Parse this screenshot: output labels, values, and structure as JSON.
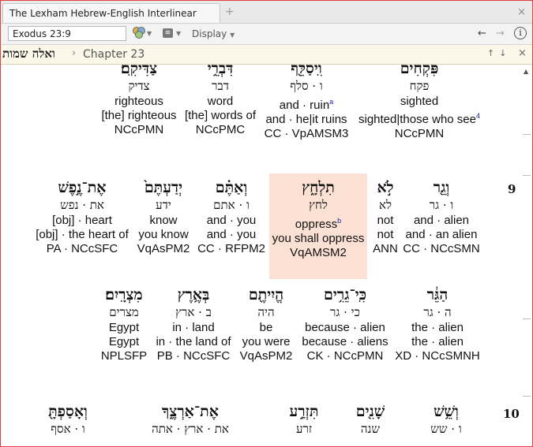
{
  "tab": {
    "title": "The Lexham Hebrew-English Interlinear Bible",
    "new_tab": "+",
    "close": "×"
  },
  "toolbar": {
    "reference": "Exodus 23:9",
    "display_label": "Display",
    "back": "←",
    "forward": "→",
    "info": "i"
  },
  "breadcrumb": {
    "book": "ואלה שמות",
    "separator": "›",
    "chapter": "Chapter 23",
    "arrows": "↑↓",
    "close": "×"
  },
  "rows": {
    "r1": [
      {
        "heb": "צַדִּיקִֽם׃",
        "lemma": "צדיק",
        "gloss": "righteous",
        "trans": "[the] righteous",
        "morph": "NCcPMN"
      },
      {
        "heb": "דִּבְרֵ֥י",
        "lemma": "דבר",
        "gloss": "word",
        "trans": "[the] words of",
        "morph": "NCcPMC"
      },
      {
        "heb": "וִֽיסַלֵּ֖ף",
        "lemma": "ו · סלף",
        "gloss": "and · ruin",
        "gloss_sup": "a",
        "trans": "and · he|it ruins",
        "morph": "CC · VpAMSM3"
      },
      {
        "heb": "פִּקְחִ֔ים",
        "lemma": "פקח",
        "gloss": "sighted",
        "trans": "sighted|those who see",
        "trans_sup": "4",
        "morph": "NCcPMN"
      }
    ],
    "r2": [
      {
        "heb": "אֶת־נֶ֣פֶשׁ",
        "lemma": "את · נפש",
        "gloss": "[obj] · heart",
        "trans": "[obj] · the heart of",
        "morph": "PA · NCcSFC"
      },
      {
        "heb": "יְדַעְתֶּם֙",
        "lemma": "ידע",
        "gloss": "know",
        "trans": "you know",
        "morph": "VqAsPM2"
      },
      {
        "heb": "וְאַתֶּ֗ם",
        "lemma": "ו · אתם",
        "gloss": "and · you",
        "trans": "and · you",
        "morph": "CC · RFPM2"
      },
      {
        "heb": "תִלְחָ֑ץ",
        "lemma": "לחץ",
        "gloss": "oppress",
        "gloss_sup": "b",
        "trans": "you shall oppress",
        "morph": "VqAMSM2"
      },
      {
        "heb": "לֹ֣א",
        "lemma": "לא",
        "gloss": "not",
        "trans": "not",
        "morph": "ANN"
      },
      {
        "heb": "וְגֵ֖ר",
        "lemma": "ו · גר",
        "gloss": "and · alien",
        "trans": "and · an alien",
        "morph": "CC · NCcSMN"
      }
    ],
    "r3": [
      {
        "heb": "מִצְרָֽיִם׃",
        "lemma": "מצרים",
        "gloss": "Egypt",
        "trans": "Egypt",
        "morph": "NPLSFP"
      },
      {
        "heb": "בְּאֶ֥רֶץ",
        "lemma": "ב · ארץ",
        "gloss": "in · land",
        "trans": "in · the land of",
        "morph": "PB · NCcSFC"
      },
      {
        "heb": "הֱיִיתֶ֖ם",
        "lemma": "היה",
        "gloss": "be",
        "trans": "you were",
        "morph": "VqAsPM2"
      },
      {
        "heb": "כִּֽי־גֵרִ֥ים",
        "lemma": "כי · גר",
        "gloss": "because · alien",
        "trans": "because · aliens",
        "morph": "CK · NCcPMN"
      },
      {
        "heb": "הַגֵּ֔ר",
        "lemma": "ה · גר",
        "gloss": "the · alien",
        "trans": "the · alien",
        "morph": "XD · NCcSMNH"
      }
    ],
    "r4": [
      {
        "heb": "וְאָסַפְתָּ֖",
        "lemma": "ו · אסף"
      },
      {
        "heb": "אֶת־אַרְצֶ֑ךָ",
        "lemma": "את · ארץ · אתה"
      },
      {
        "heb": "תִּזְרַ֣ע",
        "lemma": "זרע"
      },
      {
        "heb": "שָׁנִ֖ים",
        "lemma": "שנה"
      },
      {
        "heb": "וְשֵׁ֥שׁ",
        "lemma": "ו · שש"
      }
    ]
  },
  "verses": {
    "v9": "9",
    "v10": "10"
  }
}
